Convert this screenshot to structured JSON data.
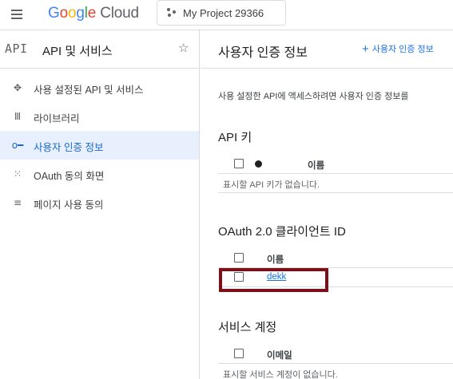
{
  "topbar": {
    "logo_google": [
      "G",
      "o",
      "o",
      "g",
      "l",
      "e"
    ],
    "logo_cloud": "Cloud",
    "project_name": "My Project 29366"
  },
  "sidebar": {
    "logo": "API",
    "title": "API 및 서비스",
    "items": [
      {
        "label": "사용 설정된 API 및 서비스",
        "icon": "enabled-apis-icon",
        "active": false
      },
      {
        "label": "라이브러리",
        "icon": "library-icon",
        "active": false
      },
      {
        "label": "사용자 인증 정보",
        "icon": "key-icon",
        "active": true
      },
      {
        "label": "OAuth 동의 화면",
        "icon": "oauth-consent-icon",
        "active": false
      },
      {
        "label": "페이지 사용 동의",
        "icon": "page-usage-icon",
        "active": false
      }
    ]
  },
  "main": {
    "title": "사용자 인증 정보",
    "create_label": "사용자 인증 정보",
    "description": "사용 설정한 API에 액세스하려면 사용자 인증 정보를",
    "api_keys": {
      "title": "API 키",
      "col_name": "이름",
      "empty": "표시할 API 키가 없습니다."
    },
    "oauth": {
      "title": "OAuth 2.0 클라이언트 ID",
      "col_name": "이름",
      "rows": [
        {
          "name": "dekk"
        }
      ]
    },
    "service_accounts": {
      "title": "서비스 계정",
      "col_email": "이메일",
      "empty": "표시할 서비스 계정이 없습니다."
    }
  },
  "colors": {
    "accent": "#1a73e8",
    "active_bg": "#e8f0fe",
    "highlight_border": "#7b1018"
  }
}
